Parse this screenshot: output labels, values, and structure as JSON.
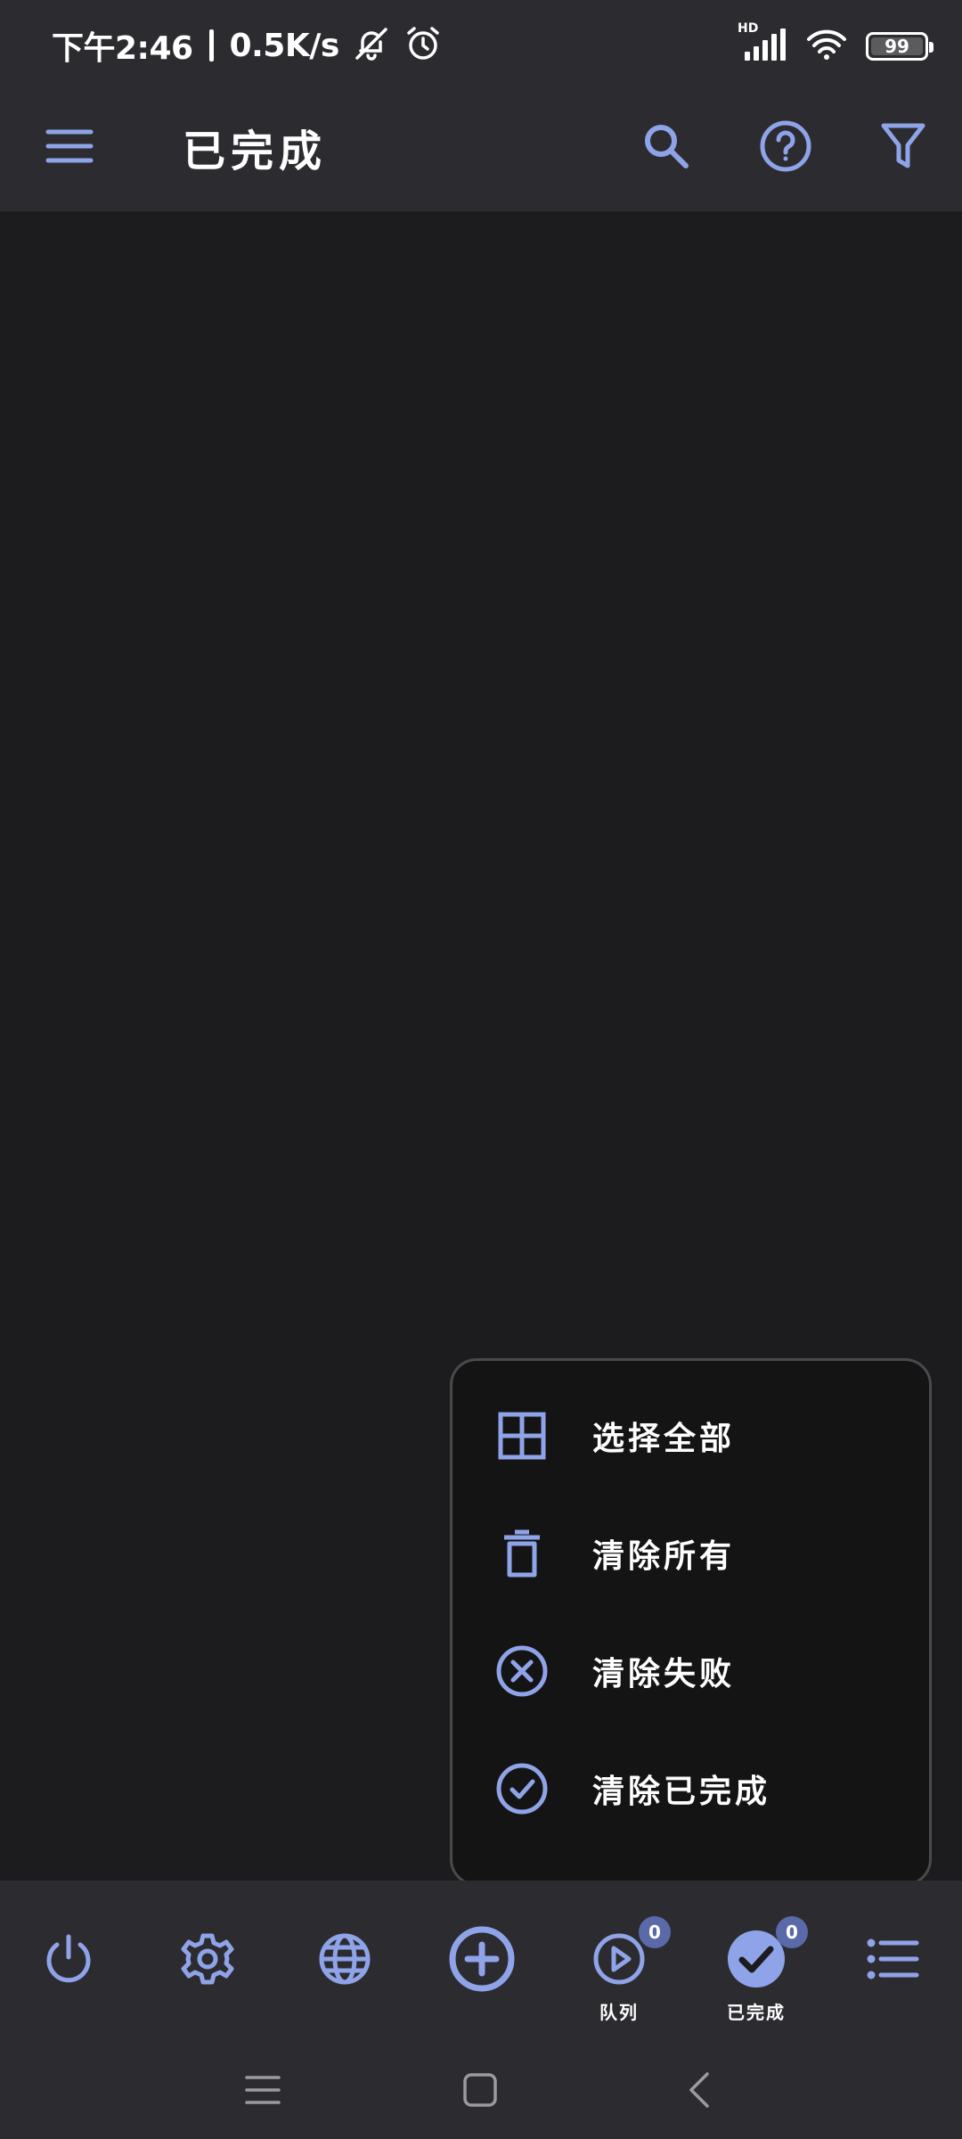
{
  "status_bar": {
    "time": "下午2:46",
    "speed": "0.5K/s",
    "signal_label": "HD",
    "battery": "99"
  },
  "app_bar": {
    "title": "已完成",
    "icons": [
      "menu-icon",
      "search-icon",
      "help-icon",
      "filter-icon"
    ]
  },
  "popup_menu": {
    "items": [
      {
        "label": "选择全部",
        "icon": "select-all-icon"
      },
      {
        "label": "清除所有",
        "icon": "trash-icon"
      },
      {
        "label": "清除失败",
        "icon": "cancel-circle-icon"
      },
      {
        "label": "清除已完成",
        "icon": "check-circle-icon"
      }
    ]
  },
  "bottom_nav": {
    "items": [
      {
        "icon": "power-icon",
        "label": ""
      },
      {
        "icon": "gear-icon",
        "label": ""
      },
      {
        "icon": "globe-icon",
        "label": ""
      },
      {
        "icon": "add-circle-icon",
        "label": ""
      },
      {
        "icon": "play-circle-icon",
        "label": "队列",
        "badge": "0"
      },
      {
        "icon": "check-circle-filled-icon",
        "label": "已完成",
        "badge": "0",
        "active": true
      },
      {
        "icon": "list-icon",
        "label": ""
      }
    ]
  },
  "colors": {
    "accent": "#8fa3e8",
    "background": "#1c1c1f",
    "bar": "#2c2c30",
    "popup": "#141414"
  }
}
